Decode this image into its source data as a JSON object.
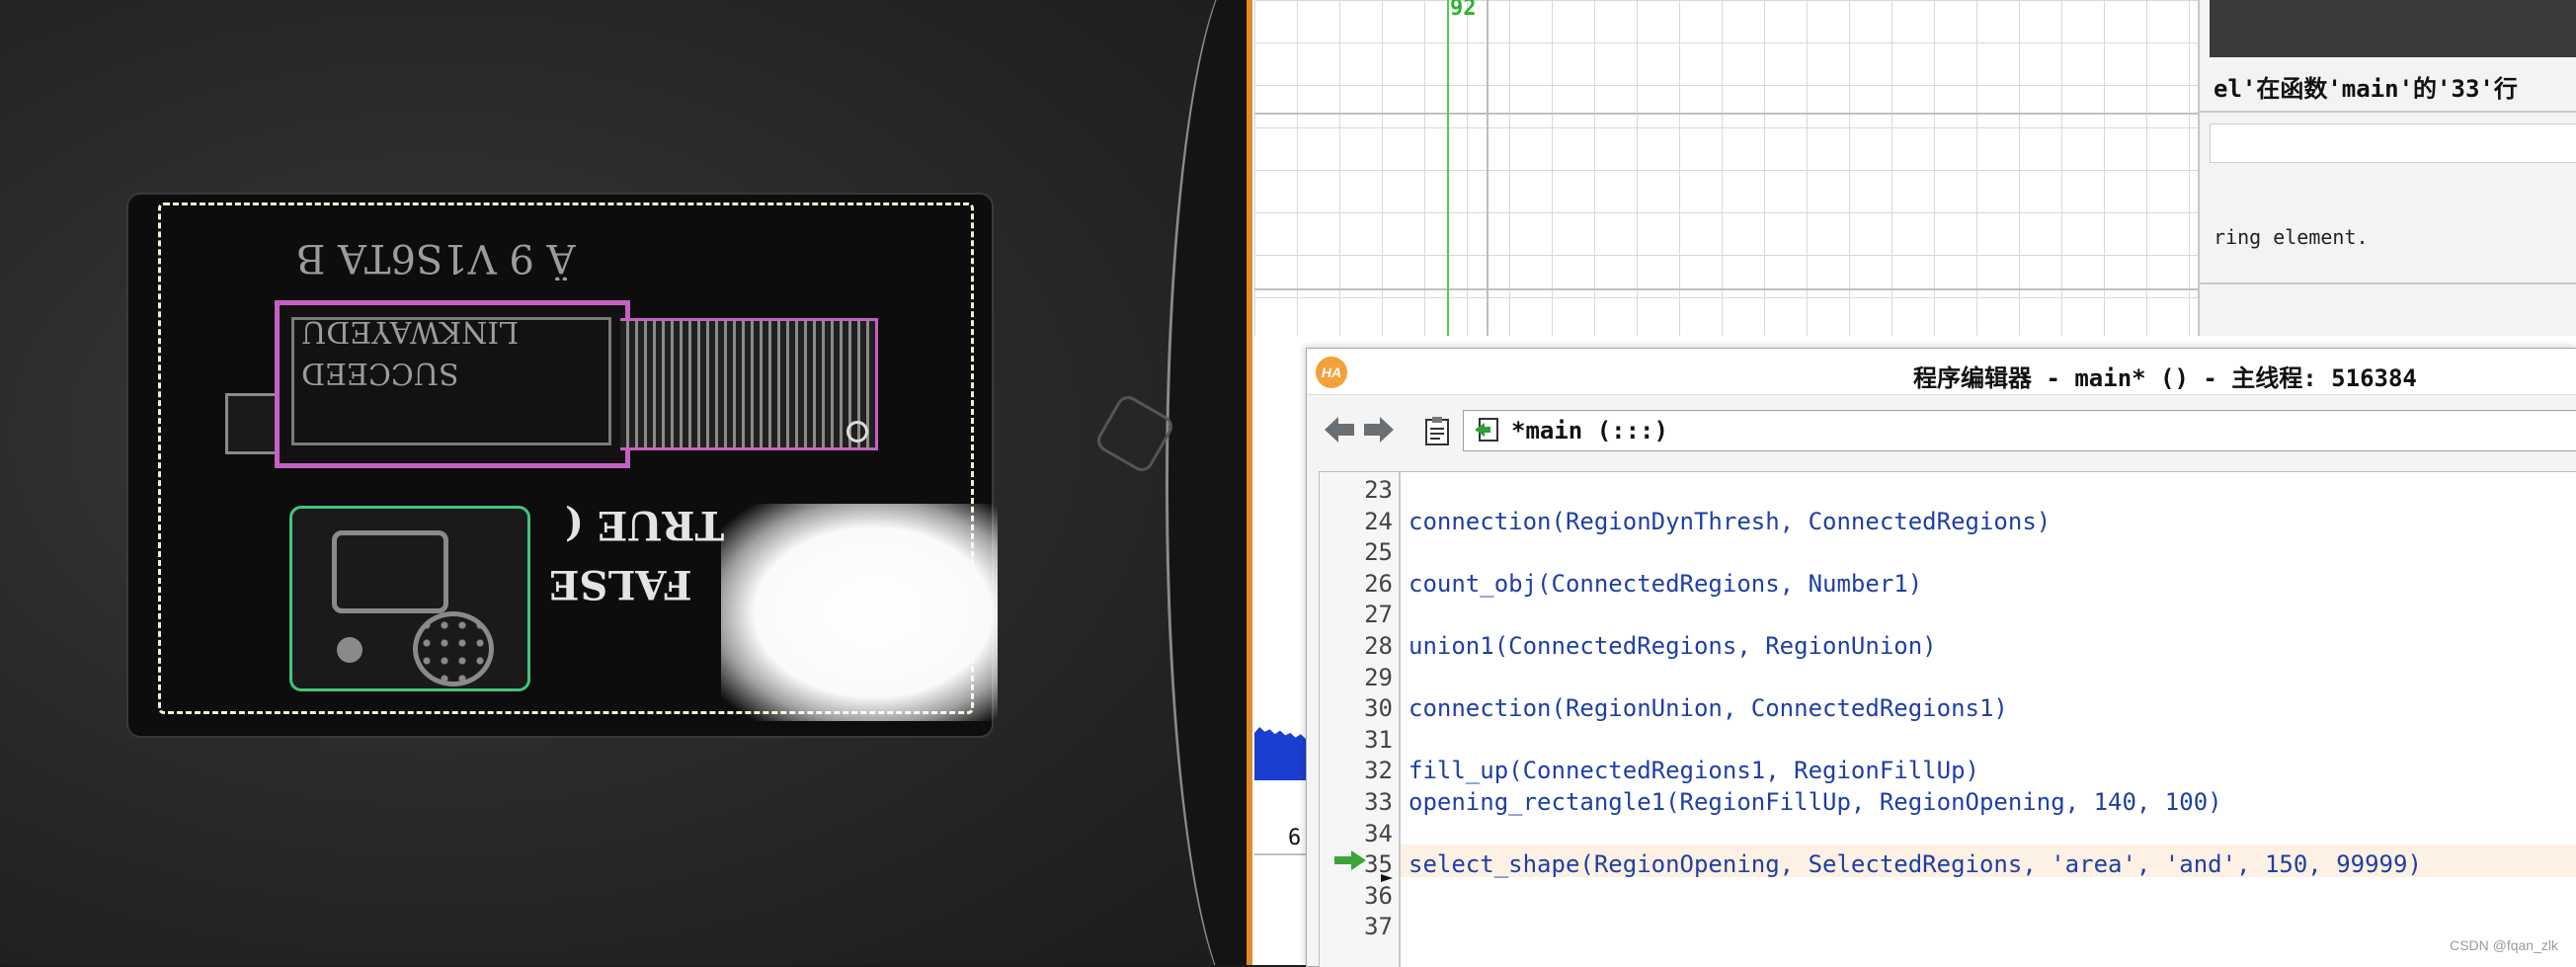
{
  "camera_view": {
    "mirror_code": "Ä 9 Ⅴ1S6TA B",
    "mirror_text_line1": "LINKWAYEDU",
    "mirror_text_line2": "SUCCEED",
    "mirror_true": "TRUE (",
    "mirror_false": "FALSE"
  },
  "plot": {
    "marker_label": "92",
    "side_digit": "6"
  },
  "message_panel": {
    "error_text": "el'在函数'main'的'33'行",
    "description": "ring element."
  },
  "editor": {
    "logo": "HA",
    "title": "程序编辑器 - main* () - 主线程: 516384",
    "procedure": "*main (:::)",
    "lines": [
      {
        "no": "23",
        "code": ""
      },
      {
        "no": "24",
        "code": "connection(RegionDynThresh, ConnectedRegions)"
      },
      {
        "no": "25",
        "code": ""
      },
      {
        "no": "26",
        "code": "count_obj(ConnectedRegions, Number1)"
      },
      {
        "no": "27",
        "code": ""
      },
      {
        "no": "28",
        "code": "union1(ConnectedRegions, RegionUnion)"
      },
      {
        "no": "29",
        "code": ""
      },
      {
        "no": "30",
        "code": "connection(RegionUnion, ConnectedRegions1)"
      },
      {
        "no": "31",
        "code": ""
      },
      {
        "no": "32",
        "code": "fill_up(ConnectedRegions1, RegionFillUp)"
      },
      {
        "no": "33",
        "code": "opening_rectangle1(RegionFillUp, RegionOpening, 140, 100)"
      },
      {
        "no": "34",
        "code": ""
      },
      {
        "no": "35",
        "code": "select_shape(RegionOpening, SelectedRegions, 'area', 'and', 150, 99999)"
      },
      {
        "no": "36",
        "code": ""
      },
      {
        "no": "37",
        "code": ""
      }
    ]
  },
  "watermark": "CSDN @fqan_zlk",
  "colors": {
    "roi_pink": "#c561c3",
    "roi_green": "#43c47a",
    "code_blue": "#1f3fa4",
    "current_line": "#fdf1e4",
    "pc_arrow": "#3aa63a"
  }
}
